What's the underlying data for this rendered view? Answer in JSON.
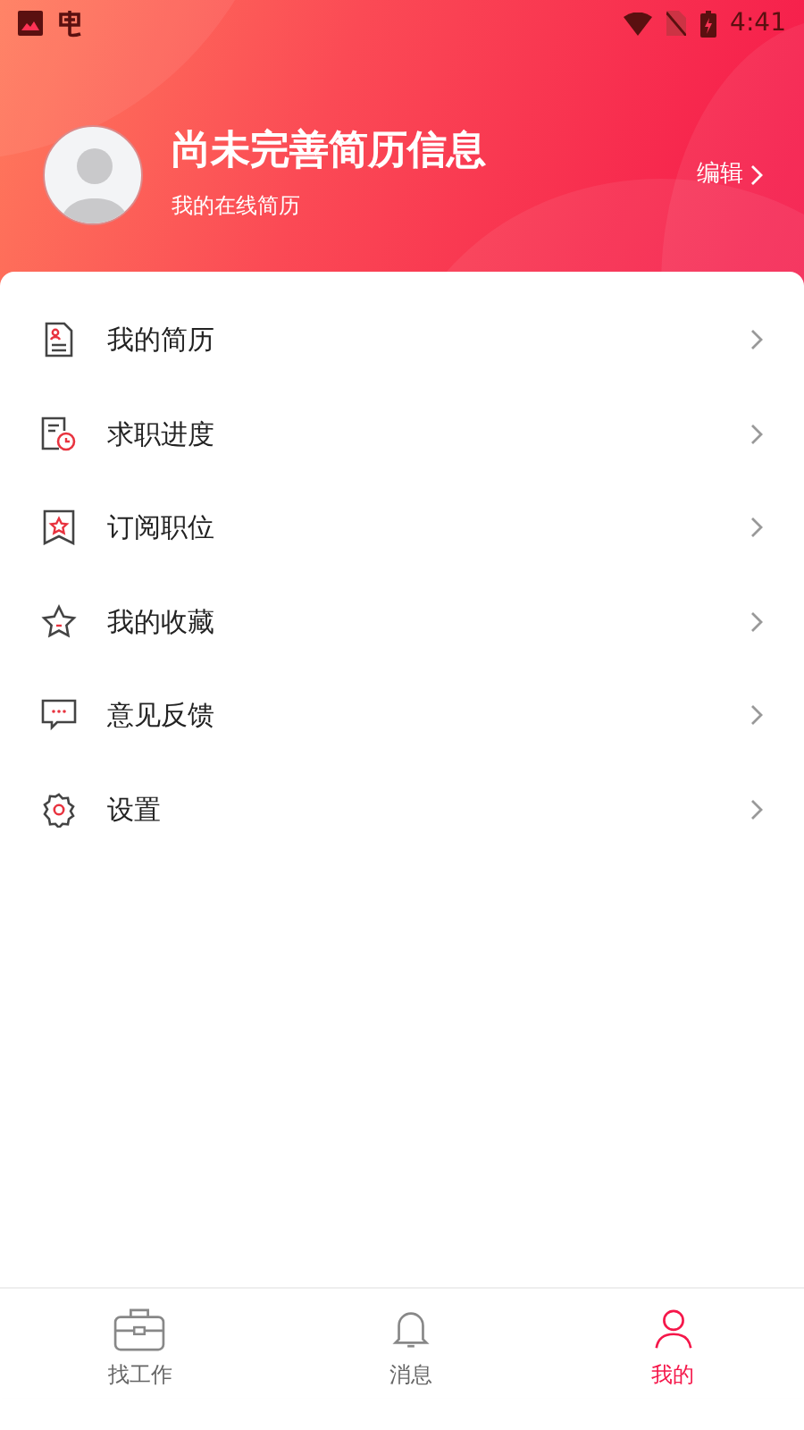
{
  "status_bar": {
    "time": "4:41"
  },
  "profile": {
    "title": "尚未完善简历信息",
    "subtitle": "我的在线简历",
    "edit": "编辑"
  },
  "menu": [
    {
      "label": "我的简历",
      "kind": "resume"
    },
    {
      "label": "求职进度",
      "kind": "progress"
    },
    {
      "label": "订阅职位",
      "kind": "subscribe"
    },
    {
      "label": "我的收藏",
      "kind": "favorite"
    },
    {
      "label": "意见反馈",
      "kind": "feedback"
    },
    {
      "label": "设置",
      "kind": "settings"
    }
  ],
  "tabs": [
    {
      "label": "找工作",
      "kind": "jobs",
      "selected": false
    },
    {
      "label": "消息",
      "kind": "messages",
      "selected": false
    },
    {
      "label": "我的",
      "kind": "me",
      "selected": true
    }
  ]
}
